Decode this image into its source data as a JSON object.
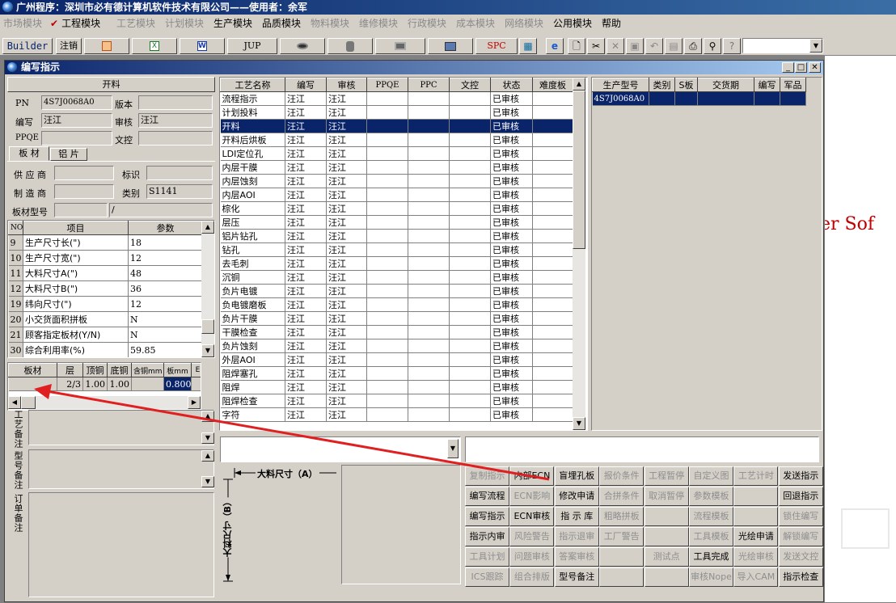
{
  "app": {
    "title": "广州程序：深圳市必有德计算机软件技术有限公司——使用者：余军",
    "window_title": "编写指示",
    "background_text": "er Sof"
  },
  "menu": [
    {
      "label": "市场模块",
      "enabled": false
    },
    {
      "label": "工程模块",
      "enabled": true,
      "checked": true
    },
    {
      "label": "工艺模块",
      "enabled": false
    },
    {
      "label": "计划模块",
      "enabled": false
    },
    {
      "label": "生产模块",
      "enabled": true
    },
    {
      "label": "品质模块",
      "enabled": true
    },
    {
      "label": "物料模块",
      "enabled": false
    },
    {
      "label": "维修模块",
      "enabled": false
    },
    {
      "label": "行政模块",
      "enabled": false
    },
    {
      "label": "成本模块",
      "enabled": false
    },
    {
      "label": "网络模块",
      "enabled": false
    },
    {
      "label": "公用模块",
      "enabled": true
    },
    {
      "label": "帮助",
      "enabled": true
    }
  ],
  "toolbar": {
    "builder": "Builder",
    "logout": "注销",
    "jup": "JUP",
    "spc": "SPC"
  },
  "left": {
    "section_title": "开料",
    "pn_label": "PN",
    "pn_value": "4S7J0068A0",
    "version_label": "版本",
    "version_value": "",
    "author_label": "编写",
    "author_value": "汪江",
    "review_label": "审核",
    "review_value": "汪江",
    "ppqe_label": "PPQE",
    "ppqe_value": "",
    "docctl_label": "文控",
    "docctl_value": "",
    "tabs": [
      "板 材",
      "铝 片"
    ],
    "supplier_label": "供 应 商",
    "supplier_value": "",
    "mark_label": "标识",
    "mark_value": "",
    "maker_label": "制 造 商",
    "maker_value": "",
    "category_label": "类别",
    "category_value": "S1141",
    "model_label": "板材型号",
    "model_value": "",
    "model_value2": "/",
    "param_headers": [
      "NO",
      "项目",
      "参数"
    ],
    "params": [
      [
        "9",
        "生产尺寸长(\")",
        "18"
      ],
      [
        "10",
        "生产尺寸宽(\")",
        "12"
      ],
      [
        "11",
        "大料尺寸A(\")",
        "48"
      ],
      [
        "12",
        "大料尺寸B(\")",
        "36"
      ],
      [
        "19",
        "纬向尺寸(\")",
        "12"
      ],
      [
        "20",
        "小交货面积拼板",
        "N"
      ],
      [
        "21",
        "顾客指定板材(Y/N)",
        "N"
      ],
      [
        "30",
        "综合利用率(%)",
        "59.85"
      ]
    ],
    "layer_headers": [
      "板材",
      "层",
      "顶铜",
      "底铜",
      "含铜mm",
      "板mm",
      "E"
    ],
    "layer_row": [
      "",
      "2/3",
      "1.00",
      "1.00",
      "",
      "0.800",
      ""
    ],
    "remark_labels": [
      "工艺备注",
      "型号备注",
      "订单备注"
    ]
  },
  "process": {
    "headers": [
      "工艺名称",
      "编写",
      "审核",
      "PPQE",
      "PPC",
      "文控",
      "状态",
      "难度板"
    ],
    "selected_index": 2,
    "rows": [
      [
        "流程指示",
        "汪江",
        "汪江",
        "",
        "",
        "",
        "已审核",
        ""
      ],
      [
        "计划投料",
        "汪江",
        "汪江",
        "",
        "",
        "",
        "已审核",
        ""
      ],
      [
        "开料",
        "汪江",
        "汪江",
        "",
        "",
        "",
        "已审核",
        ""
      ],
      [
        "开料后烘板",
        "汪江",
        "汪江",
        "",
        "",
        "",
        "已审核",
        ""
      ],
      [
        "LDI定位孔",
        "汪江",
        "汪江",
        "",
        "",
        "",
        "已审核",
        ""
      ],
      [
        "内层干膜",
        "汪江",
        "汪江",
        "",
        "",
        "",
        "已审核",
        ""
      ],
      [
        "内层蚀刻",
        "汪江",
        "汪江",
        "",
        "",
        "",
        "已审核",
        ""
      ],
      [
        "内层AOI",
        "汪江",
        "汪江",
        "",
        "",
        "",
        "已审核",
        ""
      ],
      [
        "棕化",
        "汪江",
        "汪江",
        "",
        "",
        "",
        "已审核",
        ""
      ],
      [
        "层压",
        "汪江",
        "汪江",
        "",
        "",
        "",
        "已审核",
        ""
      ],
      [
        "铝片钻孔",
        "汪江",
        "汪江",
        "",
        "",
        "",
        "已审核",
        ""
      ],
      [
        "钻孔",
        "汪江",
        "汪江",
        "",
        "",
        "",
        "已审核",
        ""
      ],
      [
        "去毛刺",
        "汪江",
        "汪江",
        "",
        "",
        "",
        "已审核",
        ""
      ],
      [
        "沉铜",
        "汪江",
        "汪江",
        "",
        "",
        "",
        "已审核",
        ""
      ],
      [
        "负片电镀",
        "汪江",
        "汪江",
        "",
        "",
        "",
        "已审核",
        ""
      ],
      [
        "负电镀磨板",
        "汪江",
        "汪江",
        "",
        "",
        "",
        "已审核",
        ""
      ],
      [
        "负片干膜",
        "汪江",
        "汪江",
        "",
        "",
        "",
        "已审核",
        ""
      ],
      [
        "干膜检查",
        "汪江",
        "汪江",
        "",
        "",
        "",
        "已审核",
        ""
      ],
      [
        "负片蚀刻",
        "汪江",
        "汪江",
        "",
        "",
        "",
        "已审核",
        ""
      ],
      [
        "外层AOI",
        "汪江",
        "汪江",
        "",
        "",
        "",
        "已审核",
        ""
      ],
      [
        "阻焊塞孔",
        "汪江",
        "汪江",
        "",
        "",
        "",
        "已审核",
        ""
      ],
      [
        "阻焊",
        "汪江",
        "汪江",
        "",
        "",
        "",
        "已审核",
        ""
      ],
      [
        "阻焊检查",
        "汪江",
        "汪江",
        "",
        "",
        "",
        "已审核",
        ""
      ],
      [
        "字符",
        "汪江",
        "汪江",
        "",
        "",
        "",
        "已审核",
        ""
      ]
    ]
  },
  "models": {
    "headers": [
      "生产型号",
      "类别",
      "S板",
      "交货期",
      "编写",
      "军品"
    ],
    "rows": [
      [
        "4S7J0068A0",
        "",
        "",
        "",
        "",
        ""
      ]
    ]
  },
  "diagram": {
    "a_label": "大料尺寸（A）",
    "b_label": "大料尺寸（B）"
  },
  "buttons": [
    [
      {
        "label": "复制指示",
        "enabled": false
      },
      {
        "label": "内部ECN",
        "enabled": true
      },
      {
        "label": "盲埋孔板",
        "enabled": true
      },
      {
        "label": "报价条件",
        "enabled": false
      },
      {
        "label": "工程暂停",
        "enabled": false
      },
      {
        "label": "自定义图",
        "enabled": false
      },
      {
        "label": "工艺计时",
        "enabled": false
      },
      {
        "label": "发送指示",
        "enabled": true
      }
    ],
    [
      {
        "label": "编写流程",
        "enabled": true
      },
      {
        "label": "ECN影响",
        "enabled": false
      },
      {
        "label": "修改申请",
        "enabled": true
      },
      {
        "label": "合拼条件",
        "enabled": false
      },
      {
        "label": "取消暂停",
        "enabled": false
      },
      {
        "label": "参数模板",
        "enabled": false
      },
      {
        "label": "",
        "enabled": false
      },
      {
        "label": "回退指示",
        "enabled": true
      }
    ],
    [
      {
        "label": "编写指示",
        "enabled": true
      },
      {
        "label": "ECN审核",
        "enabled": true
      },
      {
        "label": "指 示 库",
        "enabled": true
      },
      {
        "label": "粗略拼板",
        "enabled": false
      },
      {
        "label": "",
        "enabled": false
      },
      {
        "label": "流程模板",
        "enabled": false
      },
      {
        "label": "",
        "enabled": false
      },
      {
        "label": "锁住编写",
        "enabled": false
      }
    ],
    [
      {
        "label": "指示内审",
        "enabled": true
      },
      {
        "label": "风险警告",
        "enabled": false
      },
      {
        "label": "指示退审",
        "enabled": false
      },
      {
        "label": "工厂警告",
        "enabled": false
      },
      {
        "label": "",
        "enabled": false
      },
      {
        "label": "工具模板",
        "enabled": false
      },
      {
        "label": "光绘申请",
        "enabled": true
      },
      {
        "label": "解锁编写",
        "enabled": false
      }
    ],
    [
      {
        "label": "工具计划",
        "enabled": false
      },
      {
        "label": "问题审核",
        "enabled": false
      },
      {
        "label": "答案审核",
        "enabled": false
      },
      {
        "label": "",
        "enabled": false
      },
      {
        "label": "测试点",
        "enabled": false
      },
      {
        "label": "工具完成",
        "enabled": true
      },
      {
        "label": "光绘审核",
        "enabled": false
      },
      {
        "label": "发送文控",
        "enabled": false
      }
    ],
    [
      {
        "label": "ICS跟踪",
        "enabled": false
      },
      {
        "label": "组合排版",
        "enabled": false
      },
      {
        "label": "型号备注",
        "enabled": true
      },
      {
        "label": "",
        "enabled": false
      },
      {
        "label": "",
        "enabled": false
      },
      {
        "label": "审核Nope",
        "enabled": false
      },
      {
        "label": "导入CAM",
        "enabled": false
      },
      {
        "label": "指示检查",
        "enabled": true
      }
    ]
  ],
  "colors": {
    "title_bar": "#0a246a",
    "selection": "#0a246a",
    "arrow": "#e02020",
    "face": "#d4d0c8"
  }
}
